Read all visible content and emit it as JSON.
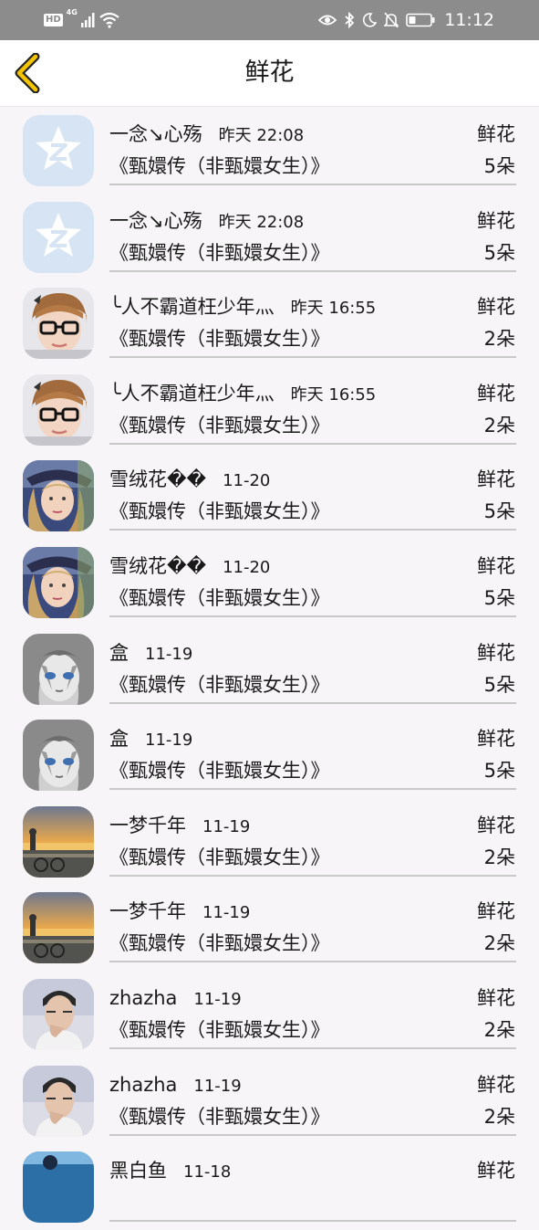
{
  "status_bar": {
    "hd": "HD",
    "network": "4G",
    "time": "11:12",
    "icons": [
      "signal-icon",
      "wifi-icon",
      "eye-icon",
      "bluetooth-icon",
      "moon-icon",
      "bell-off-icon",
      "battery-icon"
    ]
  },
  "header": {
    "title": "鲜花",
    "back_icon": "chevron-left-icon",
    "accent": "#f5c400"
  },
  "items": [
    {
      "name": "一念↘心殇",
      "time": "昨天 22:08",
      "type": "鲜花",
      "work": "《甄嬛传（非甄嬛女生）》",
      "count": "5朵",
      "avatar": "qzone-default"
    },
    {
      "name": "一念↘心殇",
      "time": "昨天 22:08",
      "type": "鲜花",
      "work": "《甄嬛传（非甄嬛女生）》",
      "count": "5朵",
      "avatar": "qzone-default"
    },
    {
      "name": "╰人不霸道枉少年灬",
      "time": "昨天 16:55",
      "type": "鲜花",
      "work": "《甄嬛传（非甄嬛女生）》",
      "count": "2朵",
      "avatar": "boy-glasses"
    },
    {
      "name": "╰人不霸道枉少年灬",
      "time": "昨天 16:55",
      "type": "鲜花",
      "work": "《甄嬛传（非甄嬛女生）》",
      "count": "2朵",
      "avatar": "boy-glasses"
    },
    {
      "name": "雪绒花��",
      "time": "11-20",
      "type": "鲜花",
      "work": "《甄嬛传（非甄嬛女生）》",
      "count": "5朵",
      "avatar": "girl-hat"
    },
    {
      "name": "雪绒花��",
      "time": "11-20",
      "type": "鲜花",
      "work": "《甄嬛传（非甄嬛女生）》",
      "count": "5朵",
      "avatar": "girl-hat"
    },
    {
      "name": "盒",
      "time": "11-19",
      "type": "鲜花",
      "work": "《甄嬛传（非甄嬛女生）》",
      "count": "5朵",
      "avatar": "anime-girl"
    },
    {
      "name": "盒",
      "time": "11-19",
      "type": "鲜花",
      "work": "《甄嬛传（非甄嬛女生）》",
      "count": "5朵",
      "avatar": "anime-girl"
    },
    {
      "name": "一梦千年",
      "time": "11-19",
      "type": "鲜花",
      "work": "《甄嬛传（非甄嬛女生）》",
      "count": "2朵",
      "avatar": "sunset"
    },
    {
      "name": "一梦千年",
      "time": "11-19",
      "type": "鲜花",
      "work": "《甄嬛传（非甄嬛女生）》",
      "count": "2朵",
      "avatar": "sunset"
    },
    {
      "name": "zhazha",
      "time": "11-19",
      "type": "鲜花",
      "work": "《甄嬛传（非甄嬛女生）》",
      "count": "2朵",
      "avatar": "man-photo"
    },
    {
      "name": "zhazha",
      "time": "11-19",
      "type": "鲜花",
      "work": "《甄嬛传（非甄嬛女生）》",
      "count": "2朵",
      "avatar": "man-photo"
    },
    {
      "name": "黑白鱼",
      "time": "11-18",
      "type": "鲜花",
      "work": "",
      "count": "",
      "avatar": "blue-photo"
    }
  ]
}
